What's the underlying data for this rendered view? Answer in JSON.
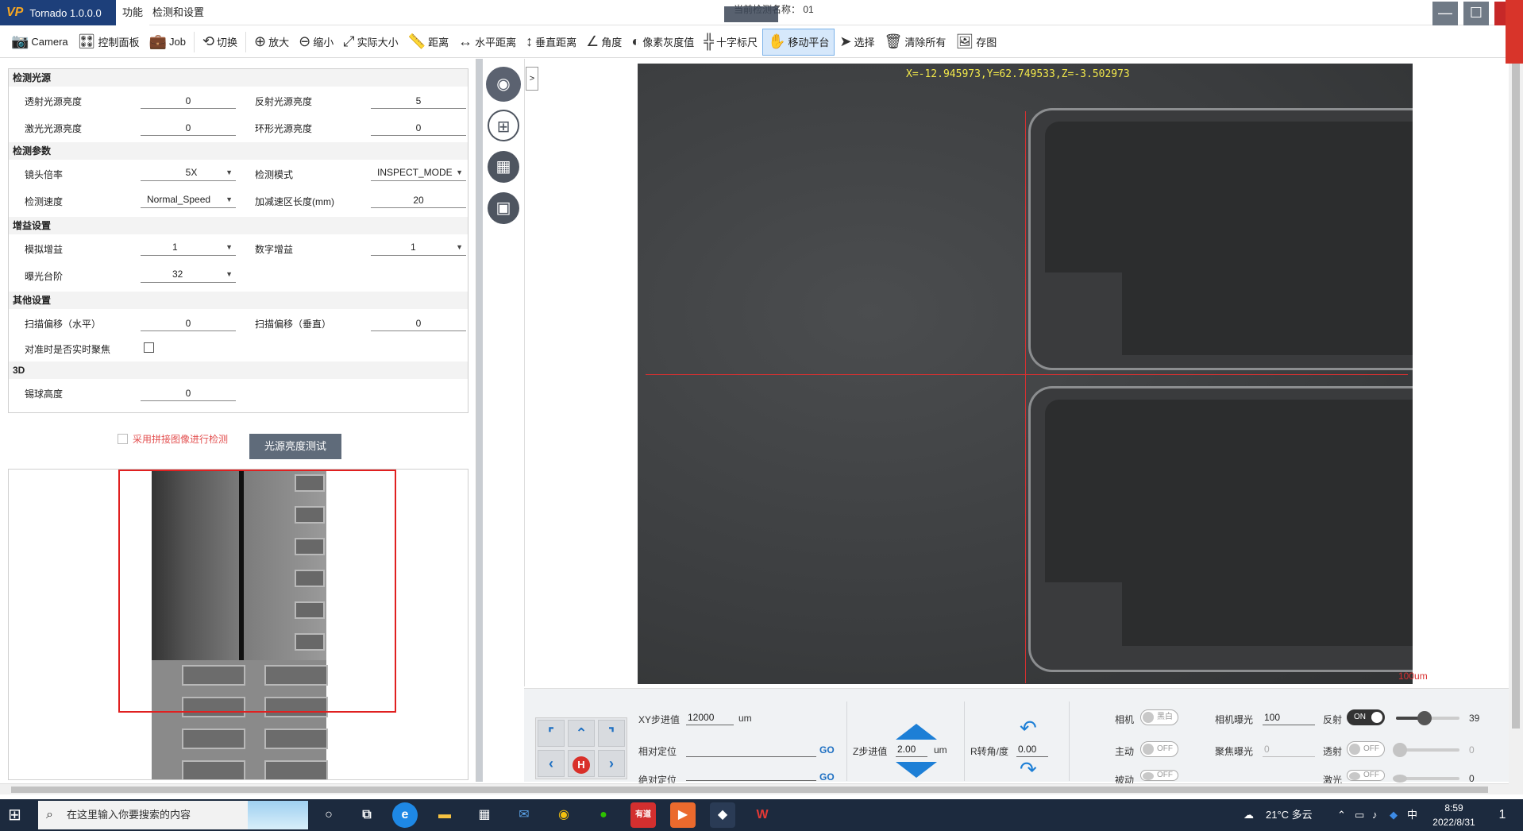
{
  "app": {
    "logo": "VP",
    "name": "Tornado 1.0.0.0",
    "menu_tabs": [
      "功能",
      "检测和设置"
    ],
    "title_label": "当前检测名称：",
    "title_value": "01",
    "window": {
      "minimize": "—",
      "maximize": "☐",
      "close": "✕"
    }
  },
  "toolbar": [
    {
      "icon": "camera-icon",
      "glyph": "📷",
      "label": "Camera"
    },
    {
      "icon": "control-panel-icon",
      "glyph": "🎛",
      "label": "控制面板"
    },
    {
      "icon": "job-icon",
      "glyph": "💼",
      "label": "Job"
    },
    {
      "icon": "switch-icon",
      "glyph": "⟲",
      "label": "切换"
    },
    {
      "icon": "zoom-in-icon",
      "glyph": "⊕",
      "label": "放大"
    },
    {
      "icon": "zoom-out-icon",
      "glyph": "⊖",
      "label": "缩小"
    },
    {
      "icon": "actual-size-icon",
      "glyph": "⤢",
      "label": "实际大小"
    },
    {
      "icon": "ruler-icon",
      "glyph": "📏",
      "label": "距离"
    },
    {
      "icon": "horizontal-distance-icon",
      "glyph": "↔",
      "label": "水平距离"
    },
    {
      "icon": "vertical-distance-icon",
      "glyph": "↕",
      "label": "垂直距离"
    },
    {
      "icon": "angle-icon",
      "glyph": "∠",
      "label": "角度"
    },
    {
      "icon": "pixel-gray-icon",
      "glyph": "◐",
      "label": "像素灰度值"
    },
    {
      "icon": "crosshair-icon",
      "glyph": "╬",
      "label": "十字标尺"
    },
    {
      "icon": "move-stage-icon",
      "glyph": "✋",
      "label": "移动平台",
      "active": true
    },
    {
      "icon": "select-icon",
      "glyph": "➤",
      "label": "选择"
    },
    {
      "icon": "clear-all-icon",
      "glyph": "🗑",
      "label": "清除所有"
    },
    {
      "icon": "save-image-icon",
      "glyph": "🖼",
      "label": "存图"
    }
  ],
  "params": {
    "light": {
      "title": "检测光源",
      "transmit_label": "透射光源亮度",
      "transmit_value": "0",
      "reflect_label": "反射光源亮度",
      "reflect_value": "5",
      "laser_label": "激光光源亮度",
      "laser_value": "0",
      "ring_label": "环形光源亮度",
      "ring_value": "0"
    },
    "detect": {
      "title": "检测参数",
      "lens_label": "镜头倍率",
      "lens_value": "5X",
      "mode_label": "检测模式",
      "mode_value": "INSPECT_MODE",
      "speed_label": "检测速度",
      "speed_value": "Normal_Speed",
      "accel_label": "加减速区长度(mm)",
      "accel_value": "20"
    },
    "gain": {
      "title": "增益设置",
      "analog_label": "模拟增益",
      "analog_value": "1",
      "digital_label": "数字增益",
      "digital_value": "1",
      "exposure_label": "曝光台阶",
      "exposure_value": "32"
    },
    "other": {
      "title": "其他设置",
      "offset_h_label": "扫描偏移（水平）",
      "offset_h_value": "0",
      "offset_v_label": "扫描偏移（垂直）",
      "offset_v_value": "0",
      "realtime_focus_label": "对准时是否实时聚焦",
      "realtime_focus_checked": false
    },
    "three_d": {
      "title": "3D",
      "ball_height_label": "锡球高度",
      "ball_height_value": "0"
    }
  },
  "stitch": {
    "label": "采用拼接图像进行检测",
    "checked": false
  },
  "light_test_button": "光源亮度测试",
  "tool_strip": {
    "expand": ">"
  },
  "camera": {
    "coords": "X=-12.945973,Y=62.749533,Z=-3.502973",
    "scale": "100um"
  },
  "controls": {
    "xy_step_label": "XY步进值",
    "xy_step_value": "12000",
    "xy_unit": "um",
    "relative_label": "相对定位",
    "relative_value": "",
    "go": "GO",
    "absolute_label": "绝对定位",
    "absolute_value": "",
    "z_step_label": "Z步进值",
    "z_step_value": "2.00",
    "z_unit": "um",
    "r_label": "R转角/度",
    "r_value": "0.00",
    "camera_label": "相机",
    "camera_toggle": "黑白",
    "active_label": "主动",
    "active_toggle": "OFF",
    "passive_label": "被动",
    "passive_toggle": "OFF",
    "cam_exposure_label": "相机曝光",
    "cam_exposure_value": "100",
    "focus_exposure_label": "聚焦曝光",
    "focus_exposure_value": "0",
    "reflect_label": "反射",
    "reflect_toggle": "ON",
    "reflect_value": "39",
    "reflect_level": 0.39,
    "transmit_label": "透射",
    "transmit_toggle": "OFF",
    "transmit_value": "0",
    "transmit_level": 0,
    "laser_label": "激光",
    "laser_toggle": "OFF",
    "laser_value": "0",
    "laser_level": 0
  },
  "taskbar": {
    "search_placeholder": "在这里输入你要搜索的内容",
    "weather": "21°C 多云",
    "ime": "中",
    "time": "8:59",
    "date": "2022/8/31",
    "notifications": "1"
  }
}
